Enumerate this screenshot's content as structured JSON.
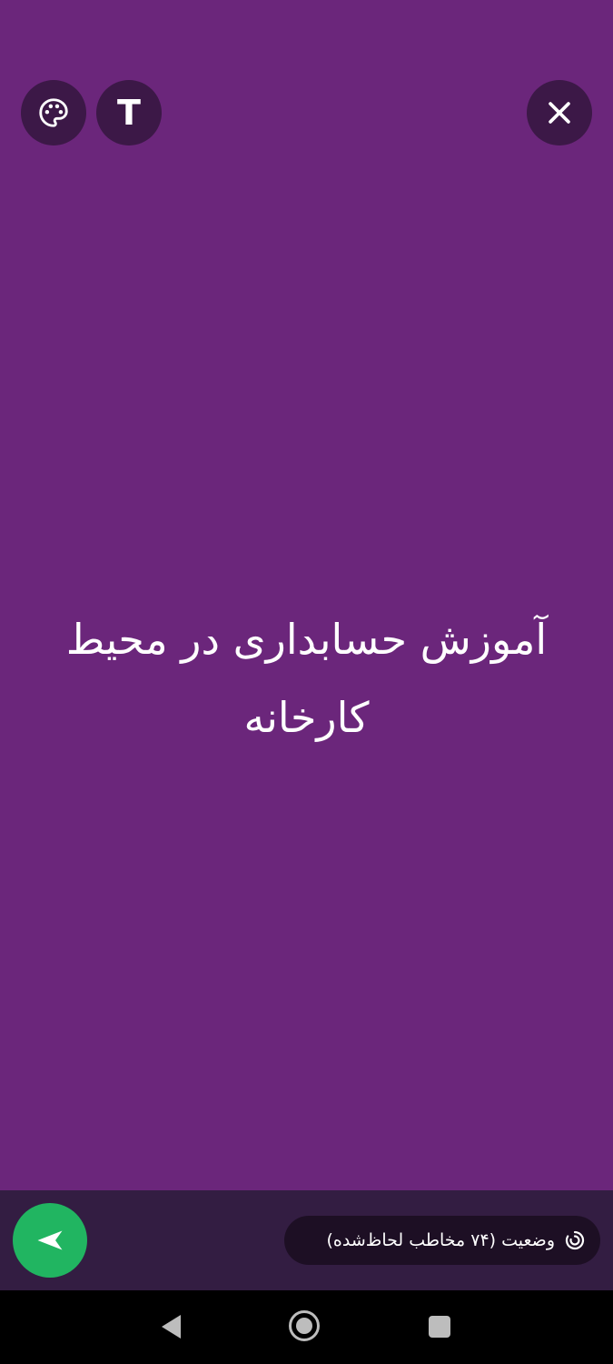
{
  "colors": {
    "canvas_background": "#6b267b",
    "round_button_background": "#3c1847",
    "bottom_bar_background": "#331d42",
    "chip_background": "#1d0f24",
    "send_button": "#21b561",
    "nav_background": "#000000",
    "nav_icon": "#bdbdbd",
    "text": "#ffffff"
  },
  "toolbar": {
    "palette_icon": "palette-icon",
    "text_tool_label": "T",
    "close_icon": "close-icon"
  },
  "status": {
    "text": "آموزش حسابداری در محیط کارخانه"
  },
  "bottom_bar": {
    "audience_label": "وضعیت (۷۴ مخاطب لحاظ‌شده)",
    "audience_icon": "status-ring-icon",
    "send_icon": "send-icon"
  },
  "navigation": {
    "back_icon": "back-triangle-icon",
    "home_icon": "home-circle-icon",
    "recents_icon": "recents-square-icon"
  }
}
